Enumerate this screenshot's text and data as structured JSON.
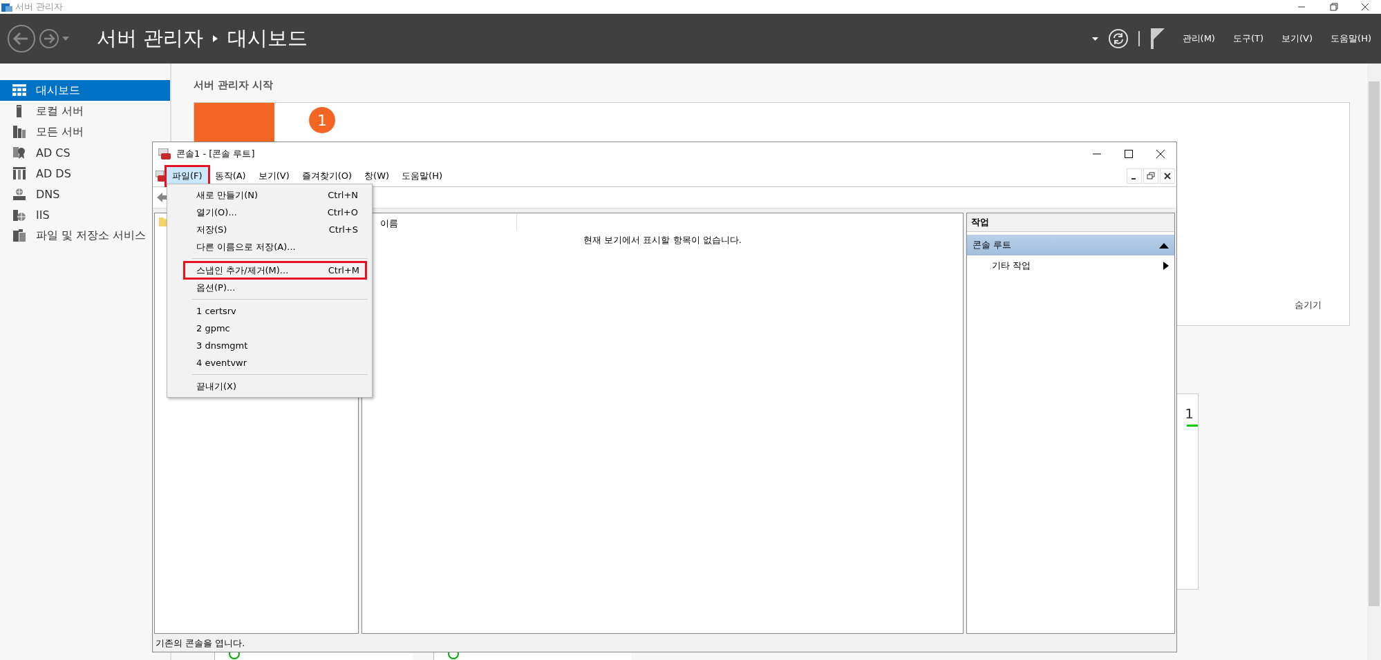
{
  "window": {
    "title": "서버 관리자"
  },
  "header": {
    "breadcrumb": [
      "서버 관리자",
      "대시보드"
    ],
    "menu": [
      "관리(M)",
      "도구(T)",
      "보기(V)",
      "도움말(H)"
    ]
  },
  "sidebar": {
    "items": [
      {
        "label": "대시보드",
        "selected": true
      },
      {
        "label": "로컬 서버",
        "selected": false
      },
      {
        "label": "모든 서버",
        "selected": false
      },
      {
        "label": "AD CS",
        "selected": false
      },
      {
        "label": "AD DS",
        "selected": false
      },
      {
        "label": "DNS",
        "selected": false
      },
      {
        "label": "IIS",
        "selected": false
      },
      {
        "label": "파일 및 저장소 서비스",
        "selected": false
      }
    ]
  },
  "welcome": {
    "heading": "서버 관리자 시작",
    "step": "1",
    "hide": "숨기기"
  },
  "tile": {
    "count": "1"
  },
  "console": {
    "title": "콘솔1 - [콘솔 루트]",
    "menu": [
      {
        "label": "파일(F)",
        "selected": true,
        "annotated": true
      },
      {
        "label": "동작(A)",
        "selected": false,
        "annotated": false
      },
      {
        "label": "보기(V)",
        "selected": false,
        "annotated": false
      },
      {
        "label": "즐겨찾기(O)",
        "selected": false,
        "annotated": false
      },
      {
        "label": "창(W)",
        "selected": false,
        "annotated": false
      },
      {
        "label": "도움말(H)",
        "selected": false,
        "annotated": false
      }
    ],
    "list": {
      "columns": [
        "이름"
      ],
      "empty_message": "현재 보기에서 표시할 항목이 없습니다."
    },
    "actions": {
      "header": "작업",
      "sections": [
        {
          "title": "콘솔 루트",
          "expanded": true,
          "items": [
            {
              "label": "기타 작업"
            }
          ]
        }
      ]
    },
    "status_bar": "기존의 콘솔을 엽니다."
  },
  "file_menu": {
    "items": [
      {
        "kind": "item",
        "label": "새로 만들기(N)",
        "shortcut": "Ctrl+N",
        "annotated": false
      },
      {
        "kind": "item",
        "label": "열기(O)...",
        "shortcut": "Ctrl+O",
        "annotated": false
      },
      {
        "kind": "item",
        "label": "저장(S)",
        "shortcut": "Ctrl+S",
        "annotated": false
      },
      {
        "kind": "item",
        "label": "다른 이름으로 저장(A)...",
        "annotated": false
      },
      {
        "kind": "separator"
      },
      {
        "kind": "item",
        "label": "스냅인 추가/제거(M)...",
        "shortcut": "Ctrl+M",
        "annotated": true
      },
      {
        "kind": "item",
        "label": "옵션(P)...",
        "annotated": false
      },
      {
        "kind": "separator"
      },
      {
        "kind": "item",
        "label": "1 certsrv",
        "annotated": false
      },
      {
        "kind": "item",
        "label": "2 gpmc",
        "annotated": false
      },
      {
        "kind": "item",
        "label": "3 dnsmgmt",
        "annotated": false
      },
      {
        "kind": "item",
        "label": "4 eventvwr",
        "annotated": false
      },
      {
        "kind": "separator"
      },
      {
        "kind": "item",
        "label": "끝내기(X)",
        "annotated": false
      }
    ]
  }
}
